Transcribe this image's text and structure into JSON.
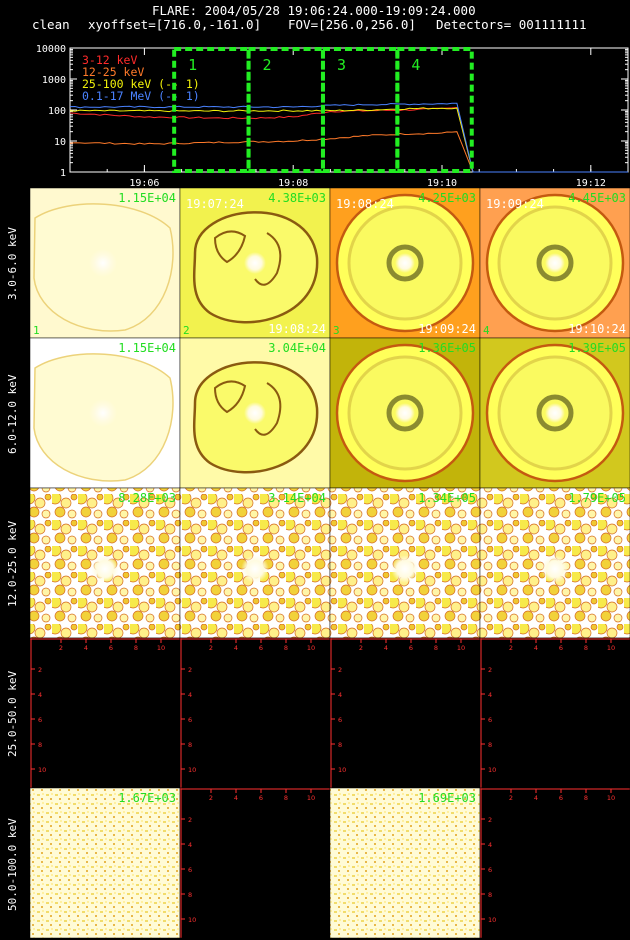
{
  "header": {
    "title": "FLARE: 2004/05/28 19:06:24.000-19:09:24.000",
    "mode": "clean",
    "xyoffset": "xyoffset=[716.0,-161.0]",
    "fov": "FOV=[256.0,256.0]",
    "detectors": "Detectors= 001111111"
  },
  "chart_data": [
    {
      "type": "line",
      "yscale": "log",
      "ylim": [
        1,
        10000
      ],
      "xlim": [
        "19:05:00",
        "19:12:30"
      ],
      "y_ticks": [
        "1",
        "10",
        "100",
        "1000",
        "10000"
      ],
      "x_ticks": [
        "19:06",
        "19:08",
        "19:10",
        "19:12"
      ],
      "legend": [
        {
          "label": "3-12 keV",
          "color": "#ff2a2a"
        },
        {
          "label": "12-25 keV",
          "color": "#ff7a2a"
        },
        {
          "label": "25-100 keV (-- 1)",
          "color": "#f2f20a"
        },
        {
          "label": "0.1-17 MeV (-- 1)",
          "color": "#4a82ff"
        }
      ],
      "series": [
        {
          "name": "3-12 keV",
          "color": "#ff2a2a",
          "x": [
            "19:05:00",
            "19:06:00",
            "19:07:00",
            "19:07:30",
            "19:08:00",
            "19:08:30",
            "19:09:00",
            "19:09:30",
            "19:10:00",
            "19:10:12",
            "19:10:25",
            "19:12:30"
          ],
          "y": [
            80,
            60,
            55,
            55,
            60,
            90,
            95,
            100,
            110,
            120,
            1,
            1
          ]
        },
        {
          "name": "12-25 keV",
          "color": "#ff7a2a",
          "x": [
            "19:05:00",
            "19:06:00",
            "19:07:00",
            "19:08:00",
            "19:08:30",
            "19:09:00",
            "19:09:30",
            "19:10:00",
            "19:10:12",
            "19:10:25",
            "19:12:30"
          ],
          "y": [
            9,
            8,
            9,
            10,
            12,
            15,
            17,
            18,
            20,
            1,
            1
          ]
        },
        {
          "name": "25-100 keV (-- 1)",
          "color": "#f2f20a",
          "x": [
            "19:05:00",
            "19:06:00",
            "19:07:00",
            "19:08:00",
            "19:08:30",
            "19:09:00",
            "19:09:30",
            "19:10:00",
            "19:10:12",
            "19:10:25",
            "19:12:30"
          ],
          "y": [
            95,
            93,
            93,
            95,
            95,
            100,
            110,
            115,
            115,
            1,
            1
          ]
        },
        {
          "name": "0.1-17 MeV (-- 1)",
          "color": "#4a82ff",
          "x": [
            "19:05:00",
            "19:06:00",
            "19:07:00",
            "19:08:00",
            "19:08:30",
            "19:09:00",
            "19:09:30",
            "19:10:00",
            "19:10:12",
            "19:10:25",
            "19:12:30"
          ],
          "y": [
            125,
            125,
            125,
            125,
            140,
            150,
            155,
            160,
            165,
            1,
            1
          ]
        }
      ],
      "intervals": [
        {
          "label": "1",
          "start": "19:06:24",
          "end": "19:07:24"
        },
        {
          "label": "2",
          "start": "19:07:24",
          "end": "19:08:24"
        },
        {
          "label": "3",
          "start": "19:08:24",
          "end": "19:09:24"
        },
        {
          "label": "4",
          "start": "19:09:24",
          "end": "19:10:24"
        }
      ]
    },
    {
      "type": "heatmap",
      "rows": [
        "3.0-6.0 keV",
        "6.0-12.0 keV",
        "12.0-25.0 keV",
        "25.0-50.0 keV",
        "50.0-100.0 keV"
      ],
      "cells": [
        [
          {
            "peak": "1.15E+04",
            "kind": "diffuse",
            "start": "",
            "end": "",
            "num": "1",
            "bg": "#fff9cf"
          },
          {
            "peak": "4.38E+03",
            "kind": "ringnoisy",
            "start": "19:07:24",
            "end": "19:08:24",
            "num": "2",
            "bg": "#f2f24e"
          },
          {
            "peak": "4.25E+03",
            "kind": "ring",
            "start": "19:08:24",
            "end": "19:09:24",
            "num": "3",
            "bg": "#ffa01e"
          },
          {
            "peak": "4.45E+03",
            "kind": "ring",
            "start": "19:09:24",
            "end": "19:10:24",
            "num": "4",
            "bg": "#ffa050"
          }
        ],
        [
          {
            "peak": "1.15E+04",
            "kind": "diffuse",
            "start": "",
            "end": "",
            "num": "",
            "bg": "#ffffff"
          },
          {
            "peak": "3.04E+04",
            "kind": "ringnoisy",
            "start": "",
            "end": "",
            "num": "",
            "bg": "#fffaa8"
          },
          {
            "peak": "1.36E+05",
            "kind": "ring",
            "start": "",
            "end": "",
            "num": "",
            "bg": "#c2b40a"
          },
          {
            "peak": "1.39E+05",
            "kind": "ring",
            "start": "",
            "end": "",
            "num": "",
            "bg": "#d2c81e"
          }
        ],
        [
          {
            "peak": "8.28E+03",
            "kind": "speckle",
            "start": "",
            "end": "",
            "num": "",
            "bg": "#ffffff"
          },
          {
            "peak": "3.14E+04",
            "kind": "speckle",
            "start": "",
            "end": "",
            "num": "",
            "bg": "#ffffff"
          },
          {
            "peak": "1.34E+05",
            "kind": "speckle",
            "start": "",
            "end": "",
            "num": "",
            "bg": "#ffffff"
          },
          {
            "peak": "1.79E+05",
            "kind": "speckle",
            "start": "",
            "end": "",
            "num": "",
            "bg": "#ffffff"
          }
        ],
        [
          {
            "peak": "",
            "kind": "empty",
            "start": "",
            "end": "",
            "num": "",
            "bg": "#000000"
          },
          {
            "peak": "",
            "kind": "empty",
            "start": "",
            "end": "",
            "num": "",
            "bg": "#000000"
          },
          {
            "peak": "",
            "kind": "empty",
            "start": "",
            "end": "",
            "num": "",
            "bg": "#000000"
          },
          {
            "peak": "",
            "kind": "empty",
            "start": "",
            "end": "",
            "num": "",
            "bg": "#000000"
          }
        ],
        [
          {
            "peak": "1.67E+03",
            "kind": "fine",
            "start": "",
            "end": "",
            "num": "",
            "bg": "#fffbd6"
          },
          {
            "peak": "",
            "kind": "empty",
            "start": "",
            "end": "",
            "num": "",
            "bg": "#000000"
          },
          {
            "peak": "1.69E+03",
            "kind": "fine",
            "start": "",
            "end": "",
            "num": "",
            "bg": "#fffbd6"
          },
          {
            "peak": "",
            "kind": "empty",
            "start": "",
            "end": "",
            "num": "",
            "bg": "#000000"
          }
        ]
      ],
      "empty_axis_ticks": [
        "2",
        "4",
        "6",
        "8",
        "10"
      ],
      "colors": {
        "peak_label": "#22dd22",
        "time_label": "#ffffff",
        "axis": "#ff3030"
      }
    }
  ]
}
